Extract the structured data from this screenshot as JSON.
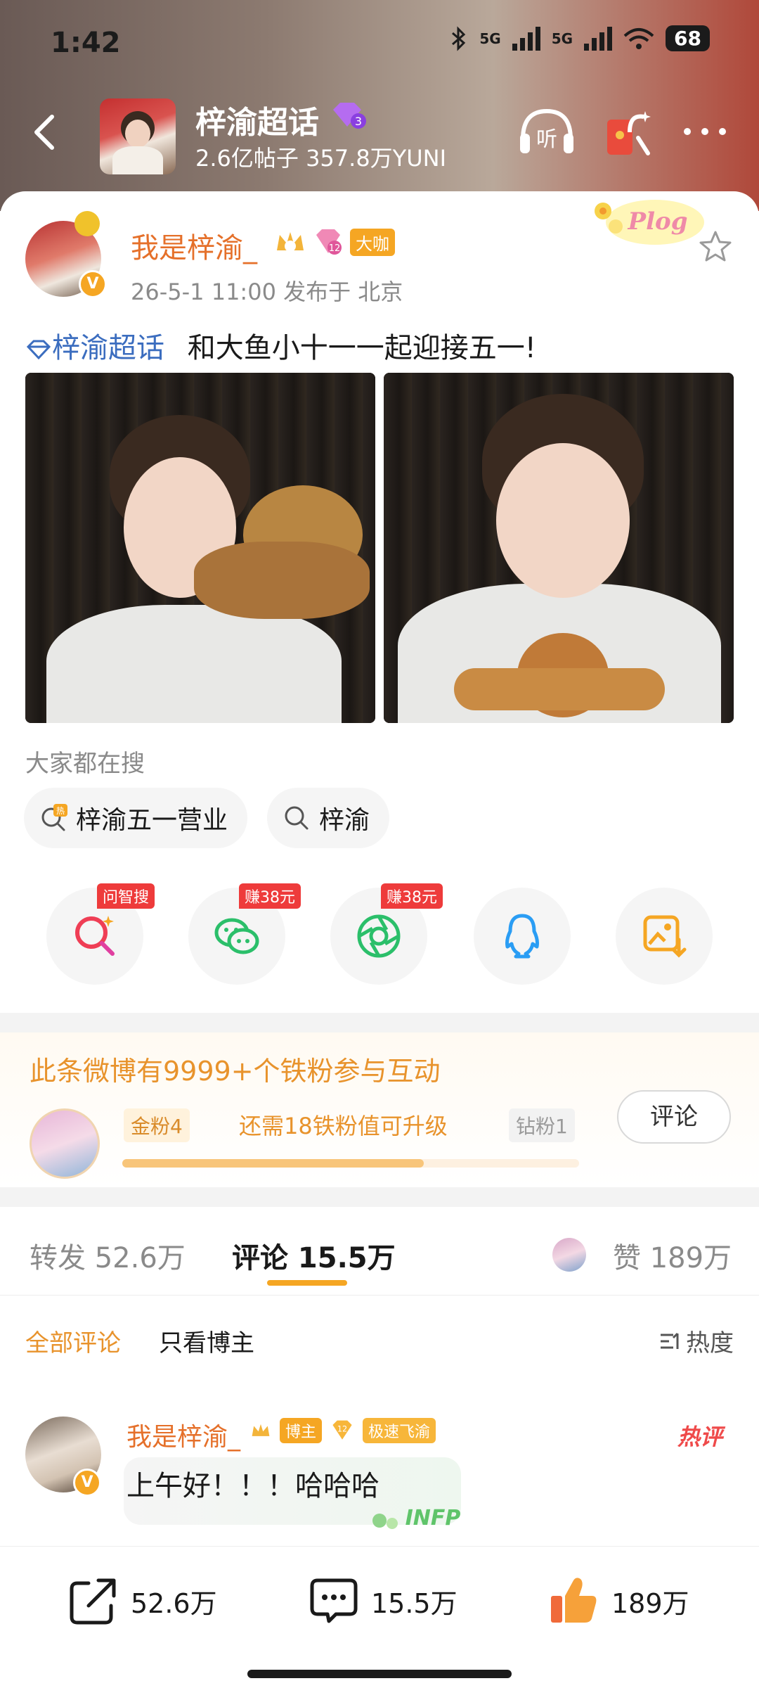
{
  "status": {
    "time": "1:42",
    "net1": "5G",
    "net2": "5G",
    "battery": "68"
  },
  "topic": {
    "title": "梓渝超话",
    "level": "3",
    "stats": "2.6亿帖子 357.8万YUNI",
    "listen_label": "听"
  },
  "post": {
    "author": "我是梓渝_",
    "badge_big": "大咖",
    "badge_level": "12",
    "meta": "26-5-1 11:00  发布于 北京",
    "topic_link": "梓渝超话",
    "text": "和大鱼小十一一起迎接五一!",
    "deco": "Plog"
  },
  "search": {
    "title": "大家都在搜",
    "chips": [
      {
        "label": "梓渝五一营业",
        "tag": "热"
      },
      {
        "label": "梓渝"
      }
    ]
  },
  "share": {
    "items": [
      {
        "name": "ask-search",
        "tag": "问智搜"
      },
      {
        "name": "wechat",
        "tag": "赚38元"
      },
      {
        "name": "moments",
        "tag": "赚38元"
      },
      {
        "name": "qq"
      },
      {
        "name": "save-image"
      }
    ]
  },
  "fans": {
    "title": "此条微博有9999+个铁粉参与互动",
    "level_left": "金粉4",
    "hint": "还需18铁粉值可升级",
    "level_right": "钻粉1",
    "progress": 0.66,
    "button": "评论"
  },
  "tabs": {
    "repost": "转发 52.6万",
    "comment": "评论 15.5万",
    "like": "赞 189万"
  },
  "filter": {
    "all": "全部评论",
    "host_only": "只看博主",
    "sort": "热度"
  },
  "comment": {
    "author": "我是梓渝_",
    "host_tag": "博主",
    "fan_level": "12",
    "fan_tag": "极速飞渝",
    "hot": "热评",
    "text": "上午好！！！哈哈哈",
    "deco": "INFP"
  },
  "bottom": {
    "repost": "52.6万",
    "comment": "15.5万",
    "like": "189万"
  }
}
